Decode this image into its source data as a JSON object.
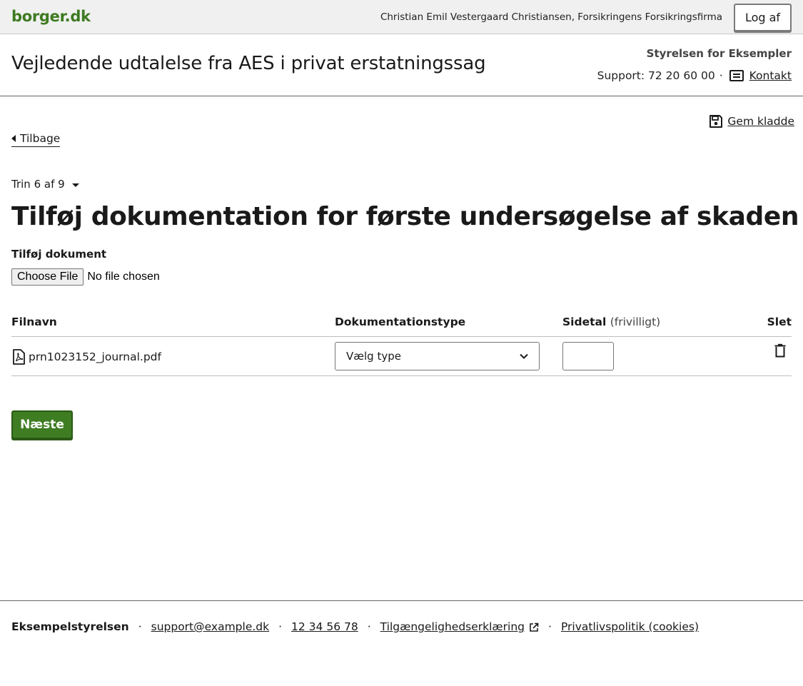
{
  "topbar": {
    "logo": "borger.dk",
    "user": "Christian Emil Vestergaard Christiansen, Forsikringens Forsikringsfirma",
    "logout_label": "Log af"
  },
  "header": {
    "service_title": "Vejledende udtalelse fra AES i privat erstatningssag",
    "authority": "Styrelsen for Eksempler",
    "support_text": "Support: 72 20 60 00",
    "separator": "·",
    "contact_label": "Kontakt"
  },
  "actions": {
    "save_draft_label": "Gem kladde",
    "back_label": "Tilbage"
  },
  "step": {
    "label": "Trin 6 af 9"
  },
  "page": {
    "heading": "Tilføj dokumentation for første undersøgelse af skaden"
  },
  "upload": {
    "label": "Tilføj dokument",
    "button_label": "Choose File",
    "status": "No file chosen"
  },
  "table": {
    "headers": {
      "filename": "Filnavn",
      "doctype": "Dokumentationstype",
      "pages": "Sidetal",
      "pages_optional": "(frivilligt)",
      "delete": "Slet"
    },
    "rows": [
      {
        "filename": "prn1023152_journal.pdf",
        "doctype_value": "Vælg type",
        "pages_value": ""
      }
    ]
  },
  "next_label": "Næste",
  "footer": {
    "org": "Eksempelstyrelsen",
    "separator": "·",
    "email": "support@example.dk",
    "phone": "12 34 56 78",
    "accessibility": "Tilgængelighedserklæring",
    "privacy": "Privatlivspolitik (cookies)"
  },
  "colors": {
    "brand_green": "#3d7a21",
    "button_green": "#3f7d23",
    "topbar_bg": "#f0f0f0"
  },
  "icons": [
    "save-icon",
    "caret-left-icon",
    "caret-down-icon",
    "message-icon",
    "pdf-file-icon",
    "chevron-down-icon",
    "trash-icon",
    "external-link-icon"
  ]
}
